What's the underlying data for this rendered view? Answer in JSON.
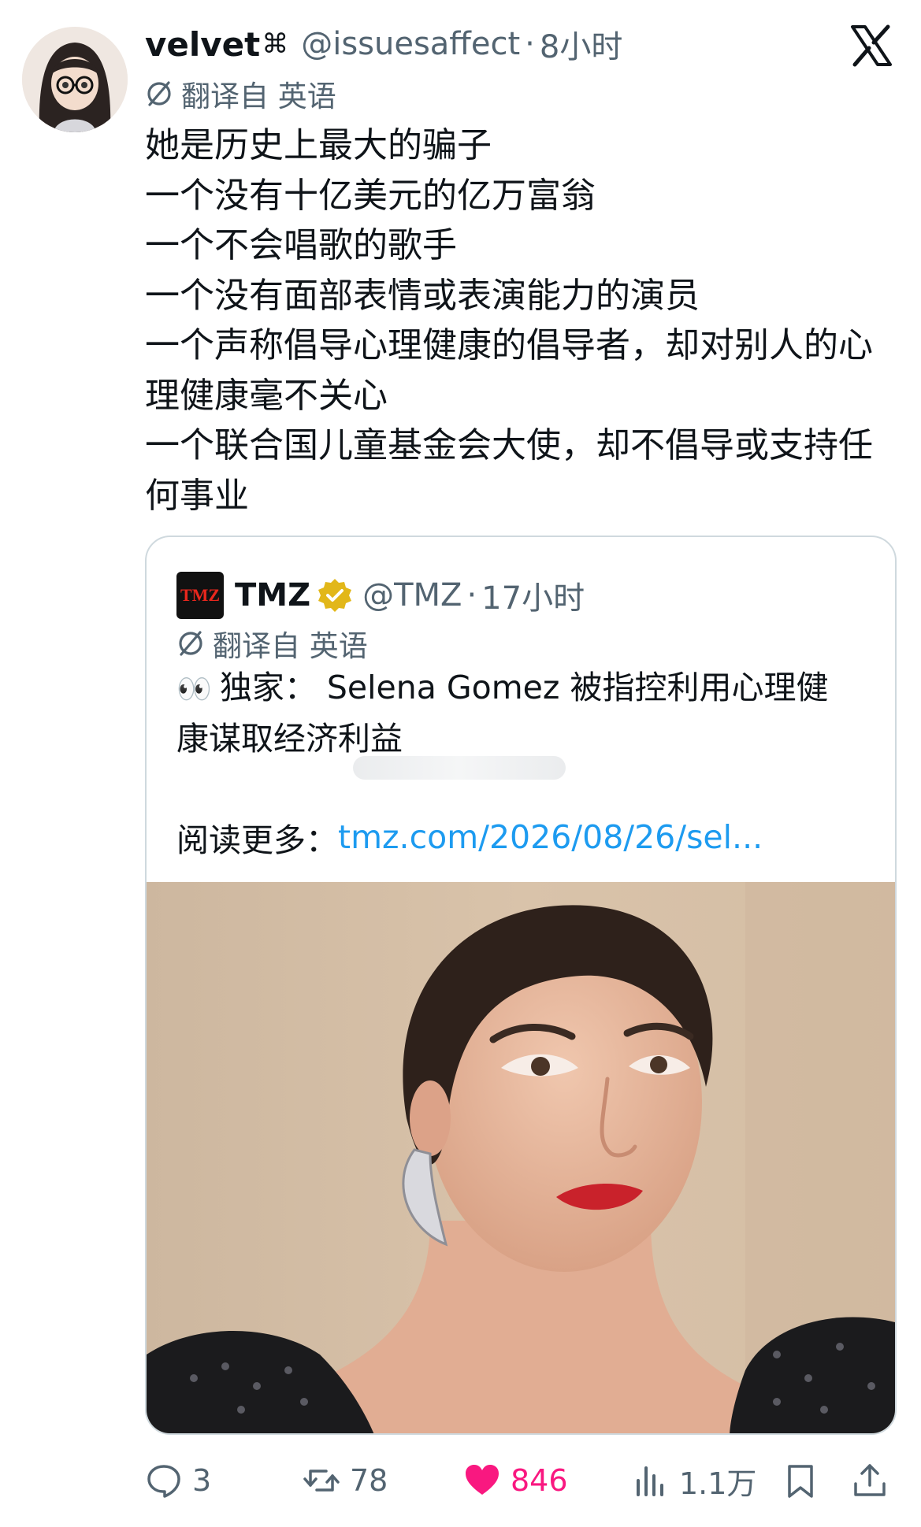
{
  "tweet": {
    "display_name": "velvet",
    "name_decoration": "⌘",
    "handle": "@issuesaffect",
    "separator": "·",
    "time": "8小时",
    "translated_label": "翻译自 英语",
    "text": "她是历史上最大的骗子\n一个没有十亿美元的亿万富翁\n一个不会唱歌的歌手\n一个没有面部表情或表演能力的演员\n一个声称倡导心理健康的倡导者，却对别人的心\n理健康毫不关心\n一个联合国儿童基金会大使，却不倡导或支持任\n何事业"
  },
  "quote": {
    "logo_text": "TMZ",
    "display_name": "TMZ",
    "handle": "@TMZ",
    "separator": "·",
    "time": "17小时",
    "translated_label": "翻译自 英语",
    "emoji": "👀",
    "text": "独家： Selena Gomez 被指控利用心理健\n康谋取经济利益",
    "read_more_label": "阅读更多：",
    "link_text": "tmz.com/2026/08/26/sel..."
  },
  "actions": {
    "replies": "3",
    "reposts": "78",
    "likes": "846",
    "views": "1.1万"
  },
  "colors": {
    "link": "#1d9bf0",
    "like": "#f91880",
    "muted": "#536471",
    "verified_gold": "#e2b719"
  }
}
